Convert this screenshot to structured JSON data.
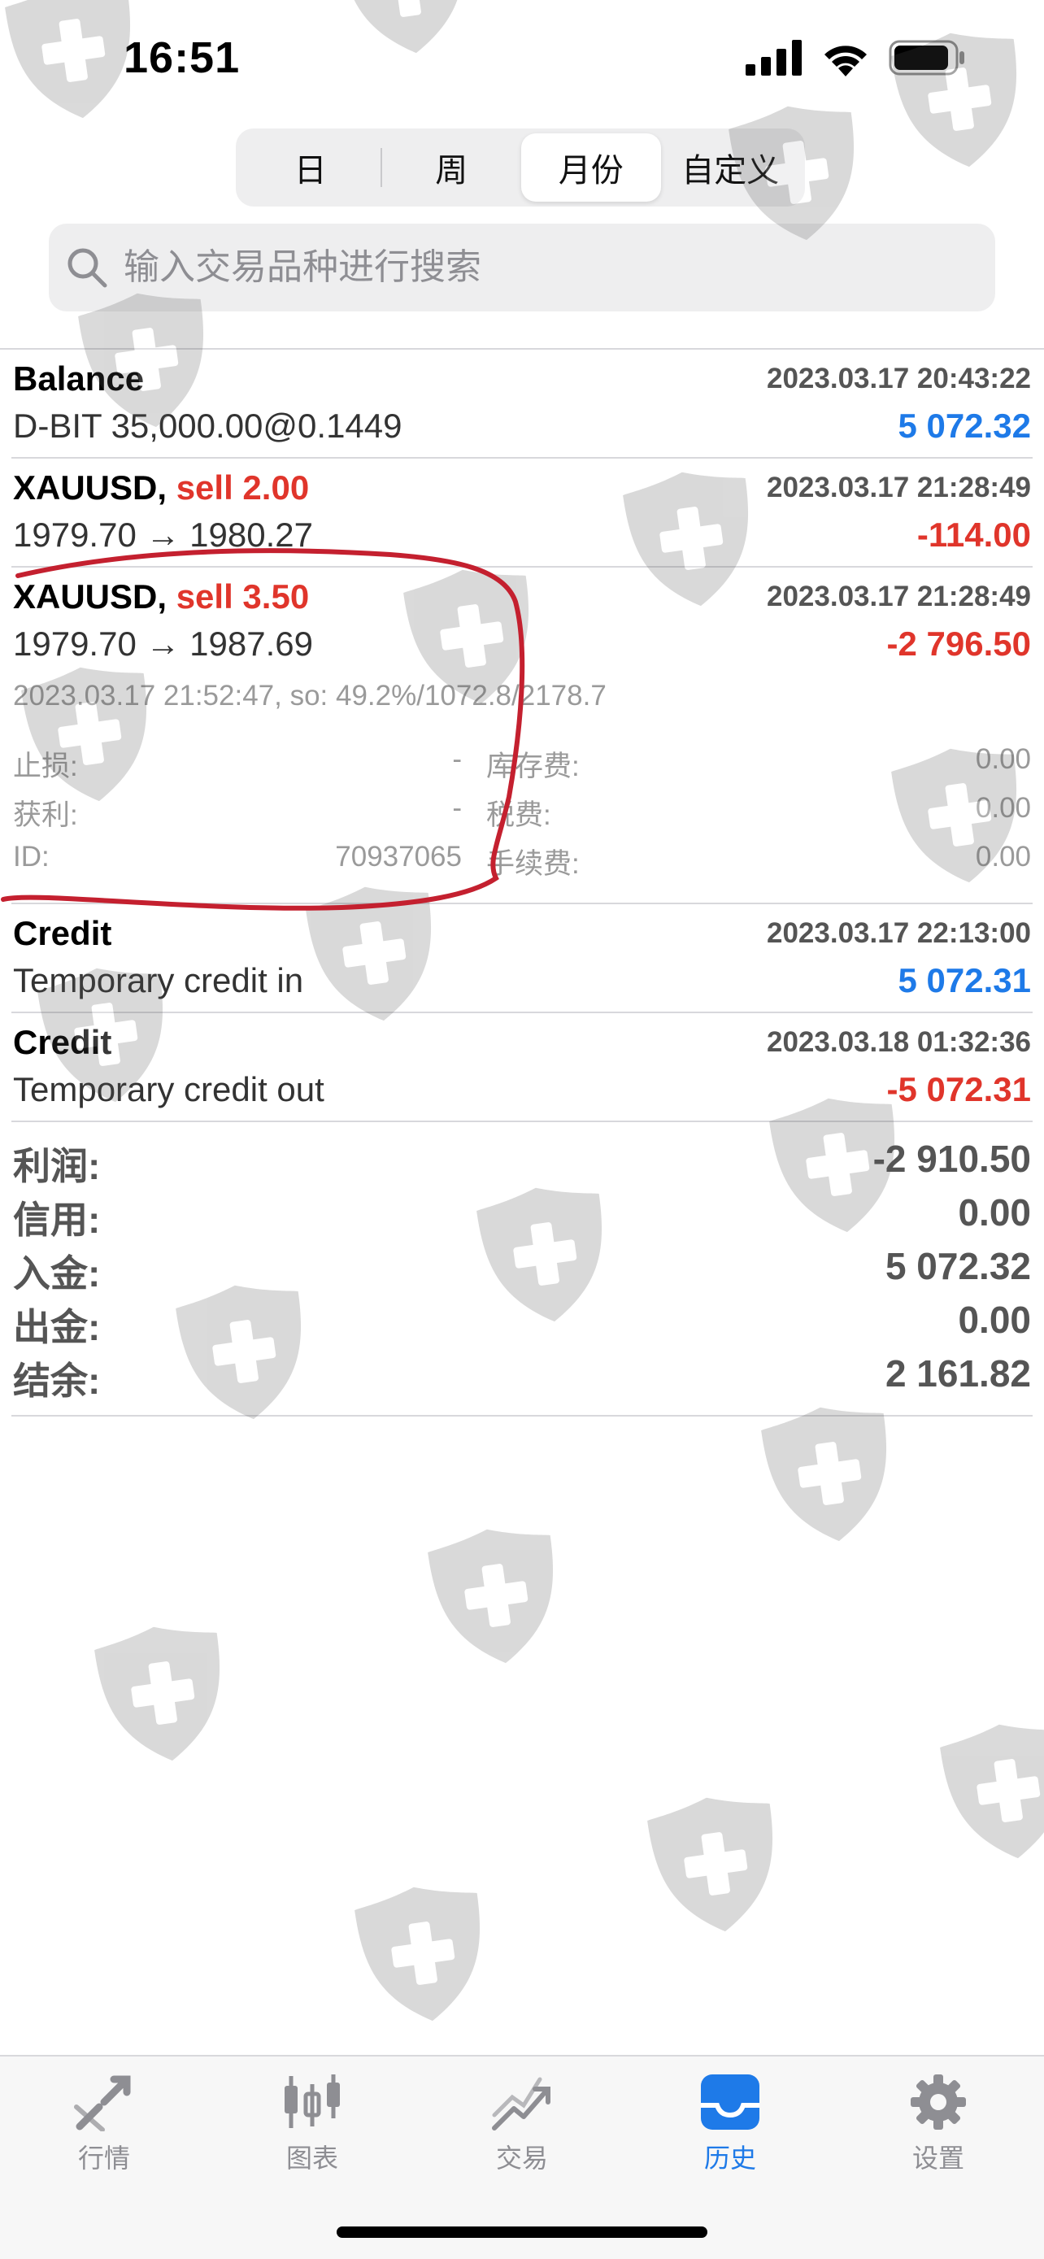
{
  "status_bar": {
    "time": "16:51"
  },
  "segmented": {
    "tabs": [
      {
        "label": "日"
      },
      {
        "label": "周"
      },
      {
        "label": "月份"
      },
      {
        "label": "自定义"
      }
    ],
    "selected_index": 2
  },
  "search": {
    "placeholder": "输入交易品种进行搜索"
  },
  "rows": {
    "balance": {
      "title": "Balance",
      "datetime": "2023.03.17 20:43:22",
      "desc": "D-BIT 35,000.00@0.1449",
      "amount": "5 072.32"
    },
    "trade1": {
      "symbol": "XAUUSD,",
      "action": "sell 2.00",
      "datetime": "2023.03.17 21:28:49",
      "prices": "1979.70 → 1980.27",
      "amount": "-114.00"
    },
    "trade2": {
      "symbol": "XAUUSD,",
      "action": "sell 3.50",
      "datetime": "2023.03.17 21:28:49",
      "prices": "1979.70 → 1987.69",
      "amount": "-2 796.50",
      "detail_line": "2023.03.17 21:52:47, so: 49.2%/1072.8/2178.7",
      "stop_loss_label": "止损:",
      "stop_loss_value": "-",
      "take_profit_label": "获利:",
      "take_profit_value": "-",
      "id_label": "ID:",
      "id_value": "70937065",
      "swap_label": "库存费:",
      "swap_value": "0.00",
      "tax_label": "税费:",
      "tax_value": "0.00",
      "commission_label": "手续费:",
      "commission_value": "0.00"
    },
    "credit_in": {
      "title": "Credit",
      "datetime": "2023.03.17 22:13:00",
      "desc": "Temporary credit in",
      "amount": "5 072.31"
    },
    "credit_out": {
      "title": "Credit",
      "datetime": "2023.03.18 01:32:36",
      "desc": "Temporary credit out",
      "amount": "-5 072.31"
    }
  },
  "summary": {
    "profit_label": "利润:",
    "profit_value": "-2 910.50",
    "credit_label": "信用:",
    "credit_value": "0.00",
    "deposit_label": "入金:",
    "deposit_value": "5 072.32",
    "withdrawal_label": "出金:",
    "withdrawal_value": "0.00",
    "balance_label": "结余:",
    "balance_value": "2 161.82"
  },
  "tab_bar": {
    "items": [
      {
        "label": "行情",
        "icon": "quotes-icon"
      },
      {
        "label": "图表",
        "icon": "chart-icon"
      },
      {
        "label": "交易",
        "icon": "trade-icon"
      },
      {
        "label": "历史",
        "icon": "history-icon"
      },
      {
        "label": "设置",
        "icon": "gear-icon"
      }
    ],
    "active_index": 3
  },
  "colors": {
    "accent_blue": "#1e7ae8",
    "loss_red": "#e0352b",
    "annotation_red": "#c4202f"
  }
}
